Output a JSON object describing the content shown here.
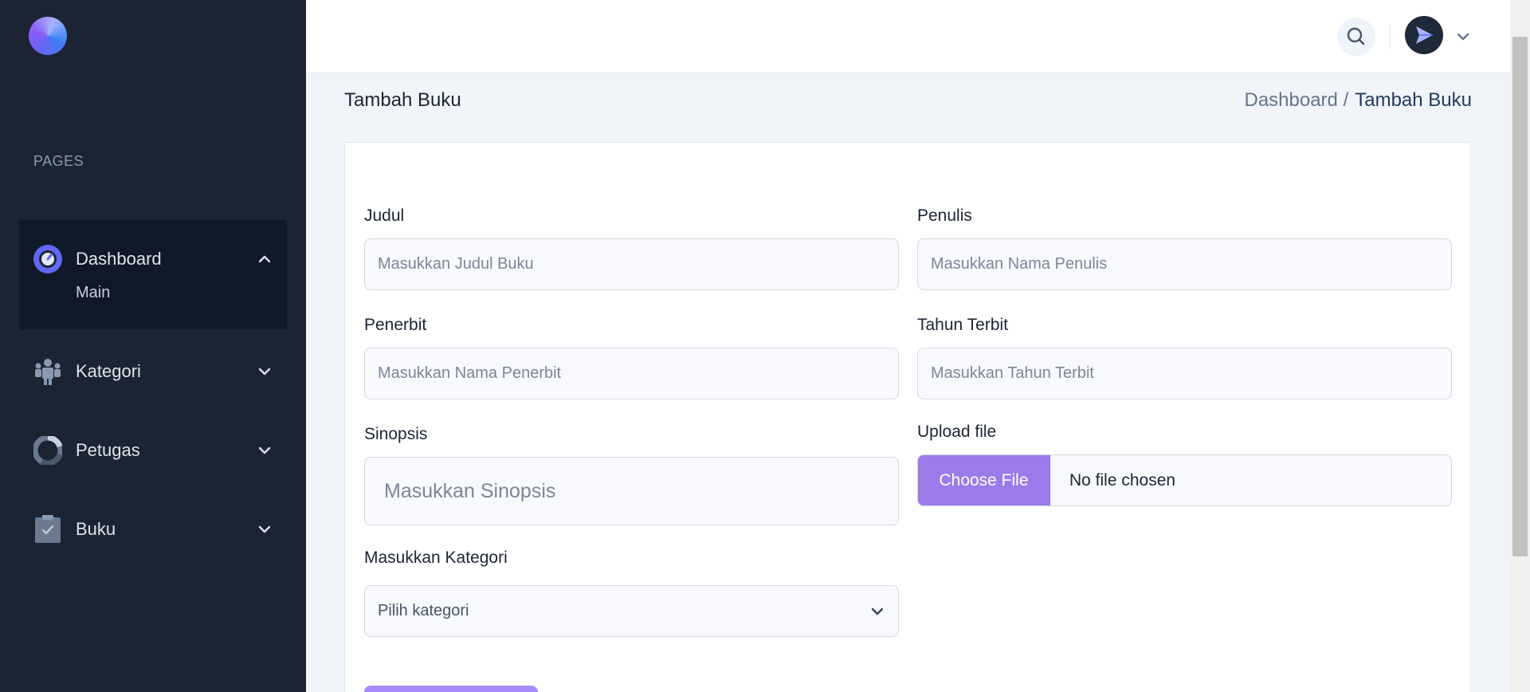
{
  "sidebar": {
    "section_label": "PAGES",
    "items": [
      {
        "label": "Dashboard",
        "icon": "dashboard-gauge-icon",
        "expanded": true,
        "sub": [
          "Main"
        ]
      },
      {
        "label": "Kategori",
        "icon": "people-icon",
        "expanded": false
      },
      {
        "label": "Petugas",
        "icon": "pie-chart-icon",
        "expanded": false
      },
      {
        "label": "Buku",
        "icon": "clipboard-check-icon",
        "expanded": false
      }
    ]
  },
  "header": {
    "search_icon": "search-icon",
    "avatar_icon": "paper-plane-icon"
  },
  "page": {
    "title": "Tambah Buku",
    "breadcrumb": {
      "parent": "Dashboard /",
      "current": "Tambah Buku"
    }
  },
  "form": {
    "judul": {
      "label": "Judul",
      "placeholder": "Masukkan Judul Buku"
    },
    "penulis": {
      "label": "Penulis",
      "placeholder": "Masukkan Nama Penulis"
    },
    "penerbit": {
      "label": "Penerbit",
      "placeholder": "Masukkan Nama Penerbit"
    },
    "tahun": {
      "label": "Tahun Terbit",
      "placeholder": "Masukkan Tahun Terbit"
    },
    "sinopsis": {
      "label": "Sinopsis",
      "placeholder": "Masukkan Sinopsis"
    },
    "upload": {
      "label": "Upload file",
      "button": "Choose File",
      "status": "No file chosen"
    },
    "kategori": {
      "label": "Masukkan Kategori",
      "selected": "Pilih kategori"
    }
  },
  "colors": {
    "sidebar_bg": "#1c2434",
    "accent": "#9b7bea",
    "active_menu_bg": "#111827"
  }
}
